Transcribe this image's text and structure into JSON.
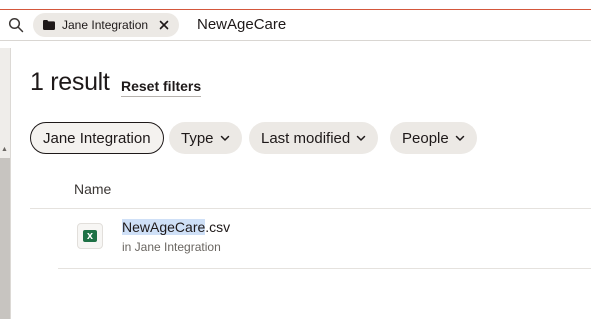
{
  "search": {
    "scope_label": "Jane Integration",
    "query": "NewAgeCare"
  },
  "results": {
    "count_text": "1 result",
    "reset_label": "Reset filters"
  },
  "filters": [
    {
      "label": "Jane Integration"
    },
    {
      "label": "Type"
    },
    {
      "label": "Last modified"
    },
    {
      "label": "People"
    }
  ],
  "table": {
    "column_name": "Name",
    "rows": [
      {
        "name_highlight": "NewAgeCare",
        "name_rest": ".csv",
        "location": "in Jane Integration",
        "icon": "excel-file-icon"
      }
    ]
  },
  "colors": {
    "accent_line": "#d4573c",
    "chip_bg": "#ece9e5",
    "highlight": "#cfe0f7",
    "excel_green": "#1e7145"
  }
}
